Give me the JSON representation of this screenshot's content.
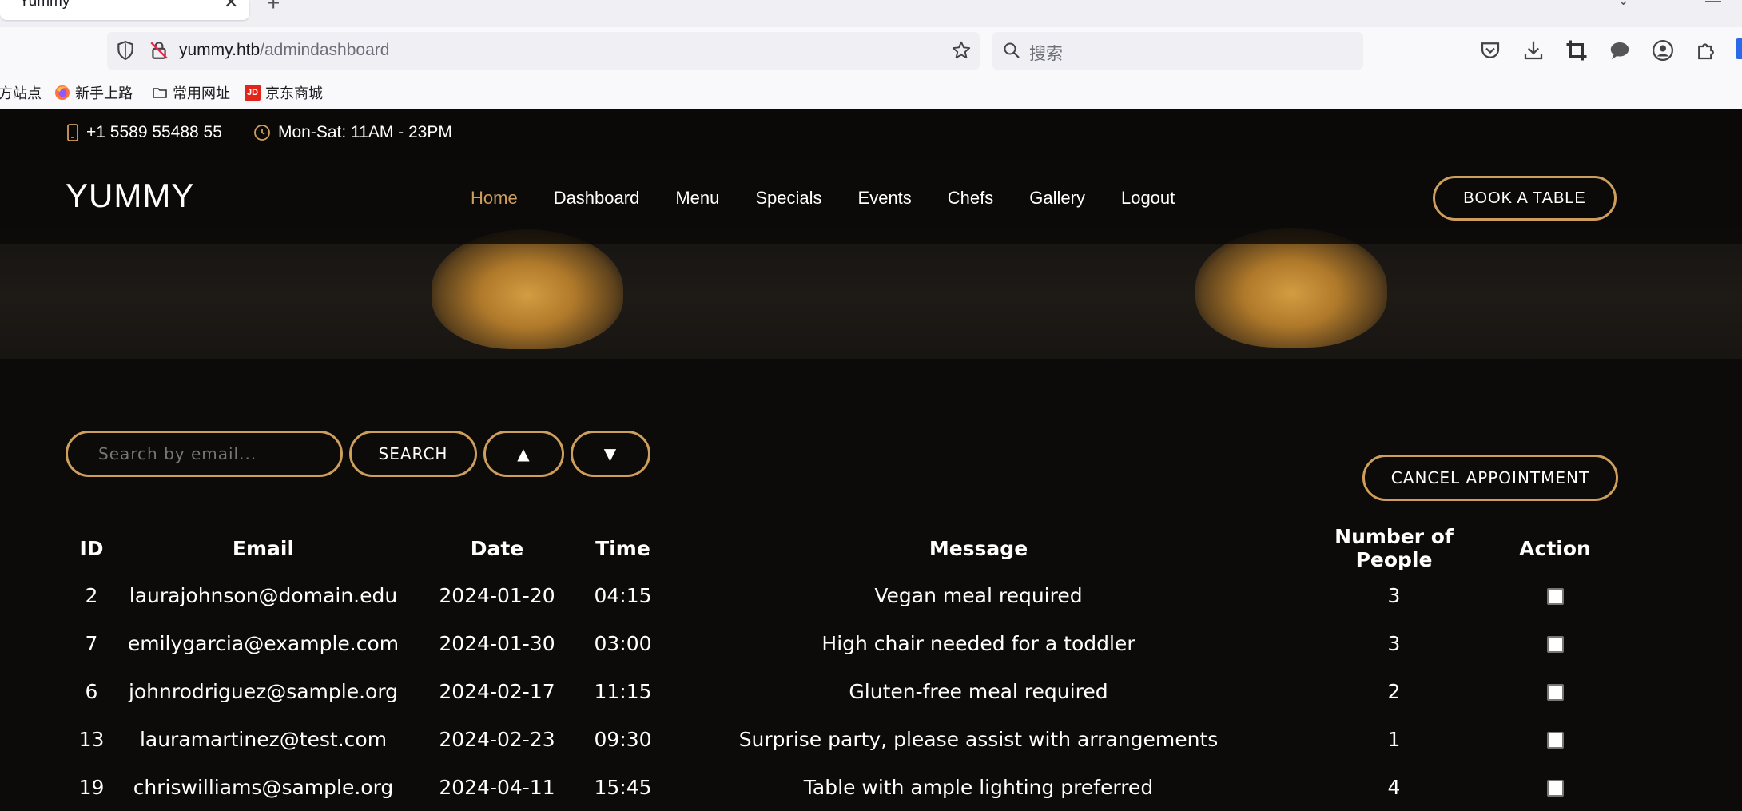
{
  "browser": {
    "tab_title": "Yummy",
    "url_host": "yummy.htb",
    "url_path": "/admindashboard",
    "search_placeholder": "搜索",
    "bookmarks": [
      {
        "label": "方站点",
        "icon": "site-icon"
      },
      {
        "label": "新手上路",
        "icon": "firefox-icon"
      },
      {
        "label": "常用网址",
        "icon": "folder-icon"
      },
      {
        "label": "京东商城",
        "icon": "jd-icon"
      }
    ],
    "toolbar_icons": [
      "pocket-icon",
      "download-icon",
      "screenshot-crop-icon",
      "chat-icon",
      "account-icon",
      "extensions-icon"
    ]
  },
  "topbar": {
    "phone": "+1 5589 55488 55",
    "hours": "Mon-Sat: 11AM - 23PM"
  },
  "header": {
    "logo": "YUMMY",
    "nav": [
      "Home",
      "Dashboard",
      "Menu",
      "Specials",
      "Events",
      "Chefs",
      "Gallery",
      "Logout"
    ],
    "active_nav": "Home",
    "book_button": "BOOK A TABLE"
  },
  "controls": {
    "search_placeholder": "Search by email...",
    "search_button": "SEARCH",
    "sort_up": "▲",
    "sort_down": "▼",
    "cancel_button": "CANCEL APPOINTMENT"
  },
  "table": {
    "columns": [
      "ID",
      "Email",
      "Date",
      "Time",
      "Message",
      "Number of People",
      "Action"
    ],
    "rows": [
      {
        "id": "2",
        "email": "laurajohnson@domain.edu",
        "date": "2024-01-20",
        "time": "04:15",
        "message": "Vegan meal required",
        "people": "3"
      },
      {
        "id": "7",
        "email": "emilygarcia@example.com",
        "date": "2024-01-30",
        "time": "03:00",
        "message": "High chair needed for a toddler",
        "people": "3"
      },
      {
        "id": "6",
        "email": "johnrodriguez@sample.org",
        "date": "2024-02-17",
        "time": "11:15",
        "message": "Gluten-free meal required",
        "people": "2"
      },
      {
        "id": "13",
        "email": "lauramartinez@test.com",
        "date": "2024-02-23",
        "time": "09:30",
        "message": "Surprise party, please assist with arrangements",
        "people": "1"
      },
      {
        "id": "19",
        "email": "chriswilliams@sample.org",
        "date": "2024-04-11",
        "time": "15:45",
        "message": "Table with ample lighting preferred",
        "people": "4"
      }
    ]
  },
  "colors": {
    "accent": "#ce9e5c",
    "background": "#0c0b09",
    "text": "#ffffff"
  }
}
